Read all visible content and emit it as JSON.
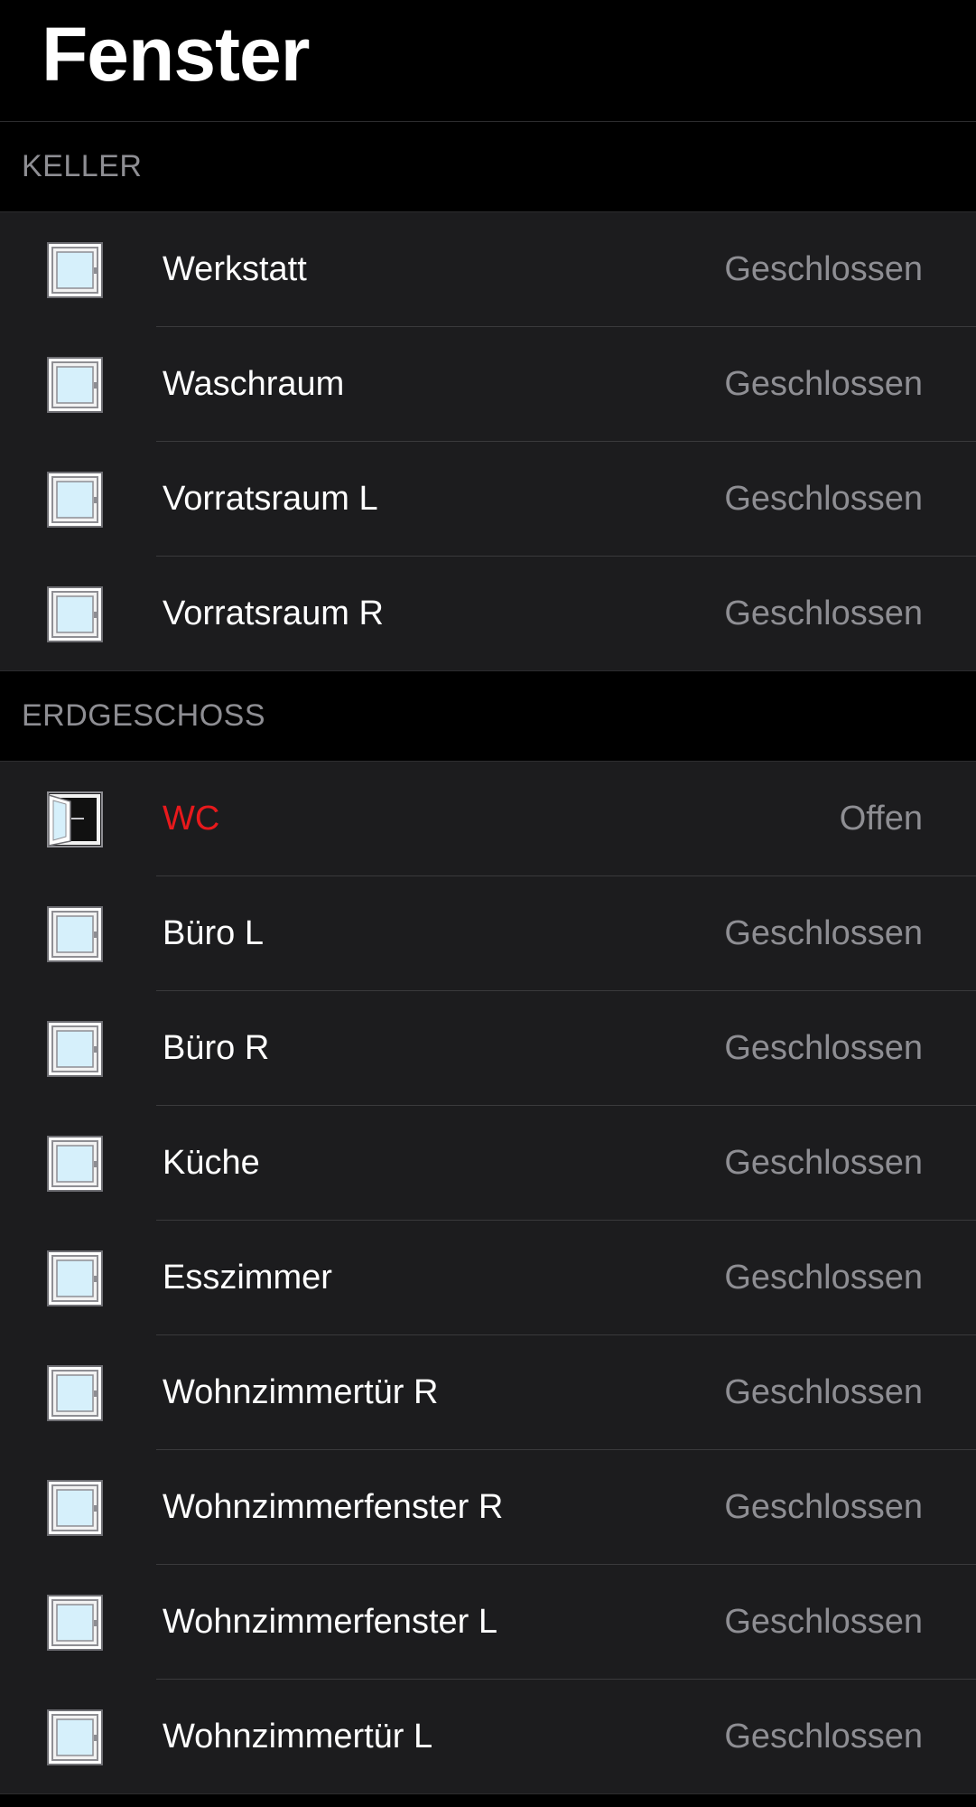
{
  "title": "Fenster",
  "sections": [
    {
      "header": "KELLER",
      "items": [
        {
          "label": "Werkstatt",
          "status": "Geschlossen",
          "state": "closed"
        },
        {
          "label": "Waschraum",
          "status": "Geschlossen",
          "state": "closed"
        },
        {
          "label": "Vorratsraum L",
          "status": "Geschlossen",
          "state": "closed"
        },
        {
          "label": "Vorratsraum R",
          "status": "Geschlossen",
          "state": "closed"
        }
      ]
    },
    {
      "header": "ERDGESCHOSS",
      "items": [
        {
          "label": "WC",
          "status": "Offen",
          "state": "open",
          "label_color": "#e8191c"
        },
        {
          "label": "Büro L",
          "status": "Geschlossen",
          "state": "closed"
        },
        {
          "label": "Büro R",
          "status": "Geschlossen",
          "state": "closed"
        },
        {
          "label": "Küche",
          "status": "Geschlossen",
          "state": "closed"
        },
        {
          "label": "Esszimmer",
          "status": "Geschlossen",
          "state": "closed"
        },
        {
          "label": "Wohnzimmertür R",
          "status": "Geschlossen",
          "state": "closed"
        },
        {
          "label": "Wohnzimmerfenster R",
          "status": "Geschlossen",
          "state": "closed"
        },
        {
          "label": "Wohnzimmerfenster L",
          "status": "Geschlossen",
          "state": "closed"
        },
        {
          "label": "Wohnzimmertür L",
          "status": "Geschlossen",
          "state": "closed"
        }
      ]
    }
  ],
  "icons": {
    "closed": "window-closed-icon",
    "open": "window-open-icon"
  },
  "colors": {
    "background": "#000000",
    "cell": "#1c1c1e",
    "secondary_text": "#8e8e93",
    "alert": "#e8191c",
    "glass": "#d6f0fb"
  }
}
